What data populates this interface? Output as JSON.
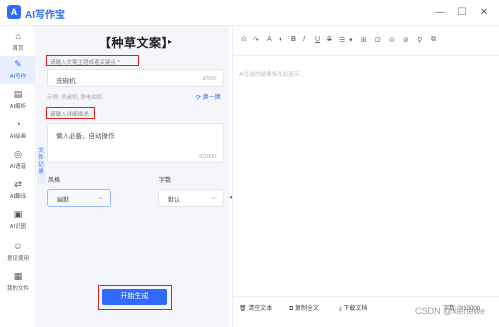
{
  "app": {
    "title": "AI写作宝",
    "logo_glyph": "A"
  },
  "window": {
    "minimize": "—",
    "maximize": "☐",
    "close": "✕"
  },
  "sidebar": {
    "items": [
      {
        "label": "首页",
        "icon": "⌂"
      },
      {
        "label": "AI写作",
        "icon": "✎",
        "active": true
      },
      {
        "label": "AI解析",
        "icon": "▤"
      },
      {
        "label": "AI绘画",
        "icon": "◔"
      },
      {
        "label": "AI语音",
        "icon": "◎"
      },
      {
        "label": "AI翻译",
        "icon": "⇄"
      },
      {
        "label": "AI识图",
        "icon": "▣"
      },
      {
        "label": "意见使用",
        "icon": "☺"
      },
      {
        "label": "我的文件",
        "icon": "▦"
      }
    ]
  },
  "panel": {
    "title": "【种草文案】",
    "title_arrow": "▸",
    "theme_label": "请输入文案主题或者关键点 *",
    "theme_value": "洗碗机",
    "theme_count": "3/500",
    "tips": "示例: 洗碗机, 联电相机",
    "swap": "换一换",
    "desc_label": "请输入详细描述",
    "desc_value": "懒人必备，自动操作",
    "desc_count": "9/1000",
    "side_tab": "文件记录",
    "style_label": "风格",
    "style_value": "幽默",
    "words_label": "字数",
    "words_value": "默认",
    "generate": "开始生成"
  },
  "editor": {
    "placeholder": "AI生成的结果将在此显示...",
    "toolbar": [
      "⎌",
      "↷",
      "A",
      "◐",
      "B",
      "I",
      "U",
      "S",
      "☰",
      "▾",
      "⊞",
      "⊡",
      "⊙",
      "⊘",
      "⚲",
      "⧉"
    ],
    "footer": {
      "clear": "清空文本",
      "copy": "复制全文",
      "download": "下载文档",
      "word_count": "字数: 0/10000"
    }
  },
  "watermark": "CSDN @xiehewe",
  "colors": {
    "accent": "#2f6bff",
    "highlight": "#e02020"
  }
}
